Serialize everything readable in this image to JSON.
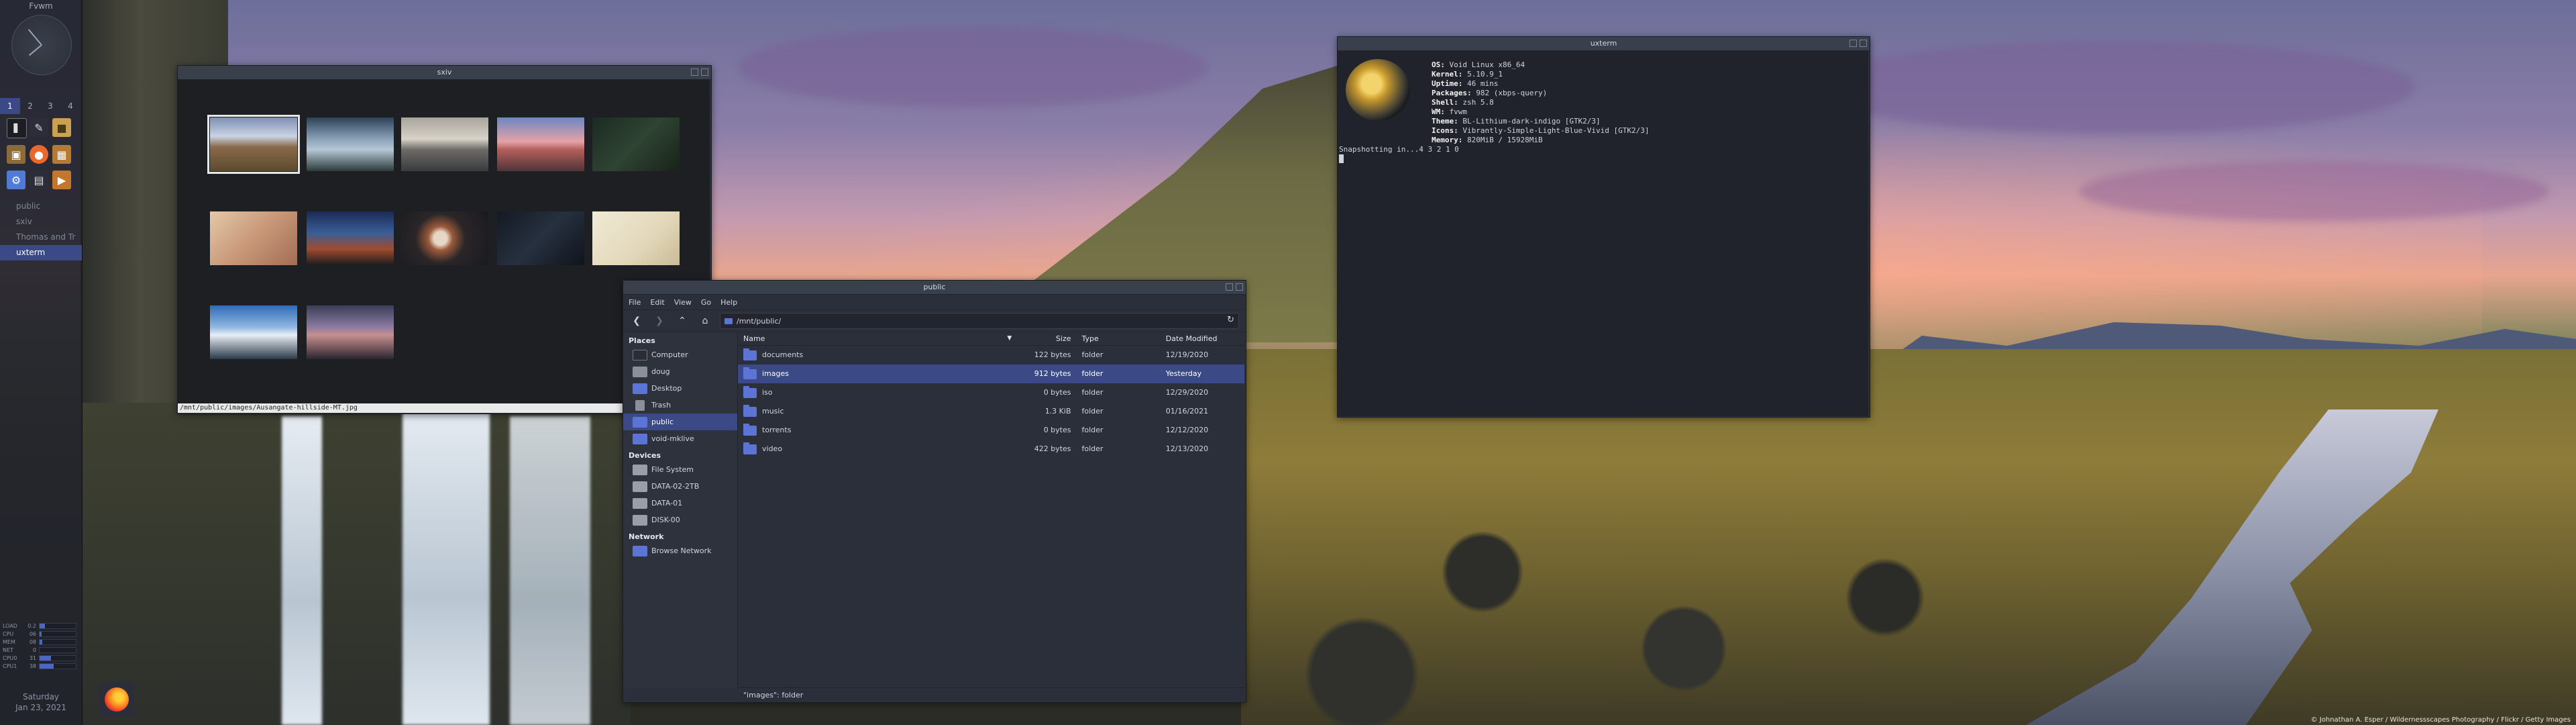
{
  "panel": {
    "title": "Fvwm",
    "desks": [
      "1",
      "2",
      "3",
      "4"
    ],
    "active_desk": 0,
    "window_list": [
      "public",
      "sxiv",
      "Thomas and Tr",
      "uxterm"
    ],
    "sysmon": [
      {
        "label": "LOAD",
        "value": "0.2",
        "fill": 0.15
      },
      {
        "label": "CPU",
        "value": "06",
        "fill": 0.06
      },
      {
        "label": "MEM",
        "value": "08",
        "fill": 0.08
      },
      {
        "label": "NET",
        "value": "0",
        "fill": 0.0
      },
      {
        "label": "CPU0",
        "value": "31",
        "fill": 0.31
      },
      {
        "label": "CPU1",
        "value": "38",
        "fill": 0.38
      }
    ],
    "date_day": "Saturday",
    "date_full": "Jan 23, 2021"
  },
  "sxiv": {
    "title": "sxiv",
    "status": "/mnt/public/images/Ausangate-hillside-MT.jpg"
  },
  "uxterm": {
    "title": "uxterm",
    "info": [
      {
        "k": "OS:",
        "v": "Void Linux x86_64"
      },
      {
        "k": "Kernel:",
        "v": "5.10.9_1"
      },
      {
        "k": "Uptime:",
        "v": "46 mins"
      },
      {
        "k": "Packages:",
        "v": "982 (xbps-query)"
      },
      {
        "k": "Shell:",
        "v": "zsh 5.8"
      },
      {
        "k": "WM:",
        "v": "fvwm"
      },
      {
        "k": "Theme:",
        "v": "BL-Lithium-dark-indigo [GTK2/3]"
      },
      {
        "k": "Icons:",
        "v": "Vibrantly-Simple-Light-Blue-Vivid [GTK2/3]"
      },
      {
        "k": "Memory:",
        "v": "820MiB / 15928MiB"
      }
    ],
    "snapshot": "Snapshotting in...4 3 2 1 0"
  },
  "fm": {
    "title": "public",
    "menu": [
      "File",
      "Edit",
      "View",
      "Go",
      "Help"
    ],
    "path": "/mnt/public/",
    "places_header": "Places",
    "places": [
      "Computer",
      "doug",
      "Desktop",
      "Trash",
      "public",
      "void-mklive"
    ],
    "active_place": 4,
    "devices_header": "Devices",
    "devices": [
      "File System",
      "DATA-02-2TB",
      "DATA-01",
      "DISK-00"
    ],
    "network_header": "Network",
    "network": [
      "Browse Network"
    ],
    "columns": {
      "name": "Name",
      "size": "Size",
      "type": "Type",
      "date": "Date Modified"
    },
    "rows": [
      {
        "name": "documents",
        "size": "122 bytes",
        "type": "folder",
        "date": "12/19/2020"
      },
      {
        "name": "images",
        "size": "912 bytes",
        "type": "folder",
        "date": "Yesterday"
      },
      {
        "name": "iso",
        "size": "0 bytes",
        "type": "folder",
        "date": "12/29/2020"
      },
      {
        "name": "music",
        "size": "1.3 KiB",
        "type": "folder",
        "date": "01/16/2021"
      },
      {
        "name": "torrents",
        "size": "0 bytes",
        "type": "folder",
        "date": "12/12/2020"
      },
      {
        "name": "video",
        "size": "422 bytes",
        "type": "folder",
        "date": "12/13/2020"
      }
    ],
    "selected_row": 1,
    "status": "\"images\": folder"
  },
  "wallpaper": {
    "credit": "© Johnathan A. Esper / Wildernessscapes Photography / Flickr / Getty Images"
  }
}
